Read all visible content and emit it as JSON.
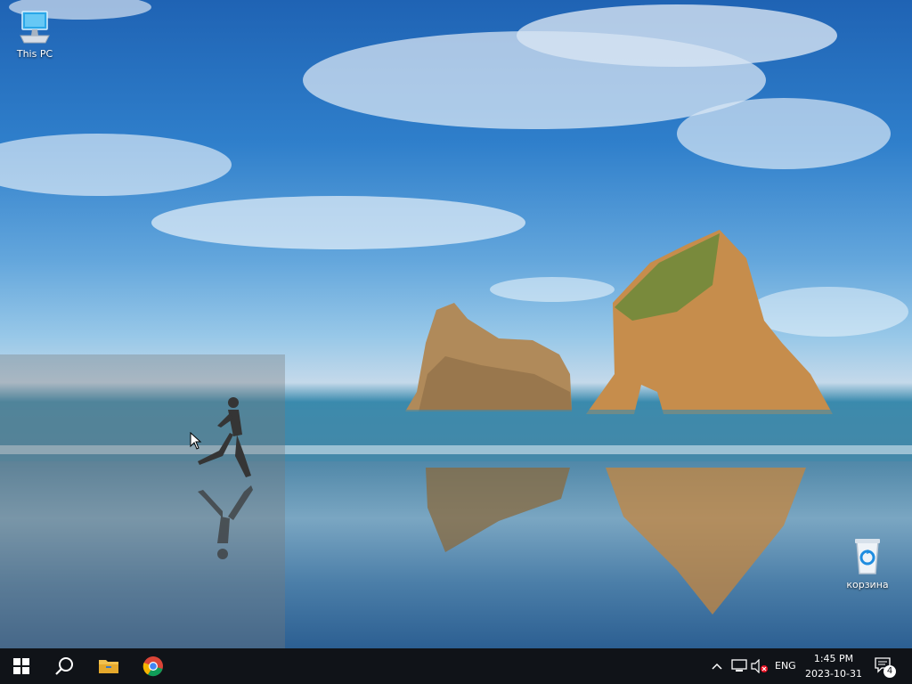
{
  "desktop": {
    "icons": [
      {
        "label": "This PC",
        "icon": "computer-icon"
      },
      {
        "label": "корзина",
        "icon": "recycle-bin-icon"
      }
    ]
  },
  "taskbar": {
    "start": {
      "icon": "windows-logo-icon"
    },
    "search": {
      "icon": "search-icon"
    },
    "pinned": [
      {
        "name": "File Explorer",
        "icon": "folder-icon"
      },
      {
        "name": "Google Chrome",
        "icon": "chrome-icon"
      }
    ],
    "tray": {
      "chevron_icon": "chevron-up-icon",
      "network_icon": "network-icon",
      "volume_icon": "volume-muted-icon",
      "language": "ENG",
      "time": "1:45 PM",
      "date": "2023-10-31",
      "notifications": {
        "icon": "notification-icon",
        "count": "4"
      }
    }
  },
  "colors": {
    "taskbar_bg": "#101318",
    "accent_sky": "#2f7fcb",
    "folder_yellow": "#f2c14e"
  }
}
